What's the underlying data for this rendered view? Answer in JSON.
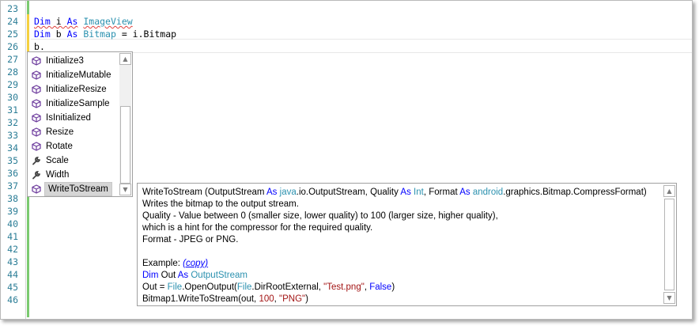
{
  "editor": {
    "line_numbers": [
      "23",
      "24",
      "25",
      "26",
      "27",
      "28",
      "29",
      "30",
      "31",
      "32",
      "33",
      "34",
      "35",
      "36",
      "37",
      "38",
      "39",
      "40",
      "41",
      "42",
      "43",
      "44",
      "45",
      "46"
    ],
    "code": {
      "l24_kw1": "Dim",
      "l24_var": " i ",
      "l24_kw2": "As",
      "l24_type": "ImageView",
      "l25_kw1": "Dim",
      "l25_var": " b ",
      "l25_kw2": "As",
      "l25_type": "Bitmap",
      "l25_rest": " = i.Bitmap",
      "l26_text": "b",
      "l26_dot": "."
    }
  },
  "autocomplete": {
    "items": [
      {
        "label": "Initialize3",
        "icon": "method-cube-icon"
      },
      {
        "label": "InitializeMutable",
        "icon": "method-cube-icon"
      },
      {
        "label": "InitializeResize",
        "icon": "method-cube-icon"
      },
      {
        "label": "InitializeSample",
        "icon": "method-cube-icon"
      },
      {
        "label": "IsInitialized",
        "icon": "method-cube-icon"
      },
      {
        "label": "Resize",
        "icon": "method-cube-icon"
      },
      {
        "label": "Rotate",
        "icon": "method-cube-icon"
      },
      {
        "label": "Scale",
        "icon": "wrench-icon"
      },
      {
        "label": "Width",
        "icon": "wrench-icon"
      },
      {
        "label": "WriteToStream",
        "icon": "method-cube-icon"
      }
    ],
    "selected_index": 9
  },
  "tooltip": {
    "sig_name": "WriteToStream (OutputStream ",
    "sig_as1": "As",
    "sig_type1": "java",
    "sig_mid1": ".io.OutputStream, Quality ",
    "sig_as2": "As",
    "sig_type2": "Int",
    "sig_mid2": ", Format ",
    "sig_as3": "As",
    "sig_type3": "android",
    "sig_end": ".graphics.Bitmap.CompressFormat)",
    "desc1": "Writes the bitmap to the output stream.",
    "desc2": "Quality - Value between 0 (smaller size, lower quality) to 100 (larger size, higher quality),",
    "desc3": "which is a hint for the compressor for the required quality.",
    "desc4": "Format - JPEG or PNG.",
    "example_label": "Example: ",
    "copy_link": "(copy)",
    "ex1_kw": "Dim",
    "ex1_var": " Out ",
    "ex1_as": "As",
    "ex1_type": " OutputStream",
    "ex2_a": "Out = ",
    "ex2_file1": "File",
    "ex2_b": ".OpenOutput(",
    "ex2_file2": "File",
    "ex2_c": ".DirRootExternal, ",
    "ex2_str": "\"Test.png\"",
    "ex2_d": ", ",
    "ex2_false": "False",
    "ex2_e": ")",
    "ex3_a": "Bitmap1.WriteToStream(out, ",
    "ex3_num": "100",
    "ex3_b": ", ",
    "ex3_str": "\"PNG\"",
    "ex3_c": ")"
  }
}
